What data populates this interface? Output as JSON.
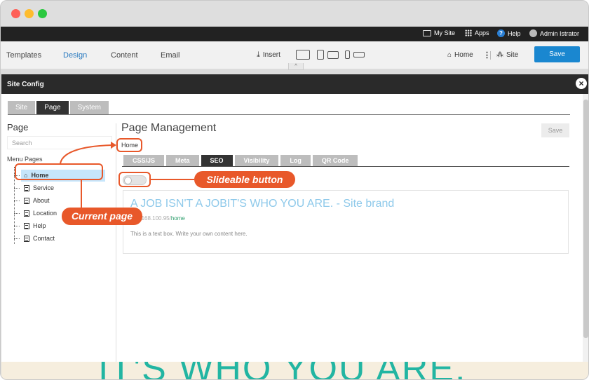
{
  "topbar": {
    "my_site": "My Site",
    "apps": "Apps",
    "help": "Help",
    "user": "Admin Istrator"
  },
  "toolbar": {
    "tabs": [
      "Templates",
      "Design",
      "Content",
      "Email"
    ],
    "active_tab": "Design",
    "insert": "Insert",
    "home": "Home",
    "site": "Site",
    "save": "Save"
  },
  "modal": {
    "title": "Site Config",
    "tabs": [
      "Site",
      "Page",
      "System"
    ],
    "active_tab": "Page"
  },
  "left": {
    "header": "Page",
    "search_placeholder": "Search",
    "menu_title": "Menu Pages",
    "pages": [
      "Home",
      "Service",
      "About",
      "Location",
      "Help",
      "Contact"
    ],
    "active_page": "Home"
  },
  "main": {
    "title": "Page Management",
    "save": "Save",
    "breadcrumb": "Home",
    "tabs": [
      "CSS/JS",
      "Meta",
      "SEO",
      "Visibility",
      "Log",
      "QR Code"
    ],
    "active_tab": "SEO",
    "preview": {
      "heading": "A JOB ISN'T A JOBIT'S WHO YOU ARE. - Site brand",
      "url_prefix": "192.168.100.95/",
      "url_page": "home",
      "text": "This is a text box. Write your own content here."
    }
  },
  "background_text": "IT'S WHO YOU ARE.",
  "annotations": {
    "slideable": "Slideable button",
    "current_page": "Current page"
  },
  "colors": {
    "accent": "#e8582a",
    "save_blue": "#1a87d0",
    "active_design": "#2b7bc0",
    "highlight": "#c6e6fb"
  }
}
